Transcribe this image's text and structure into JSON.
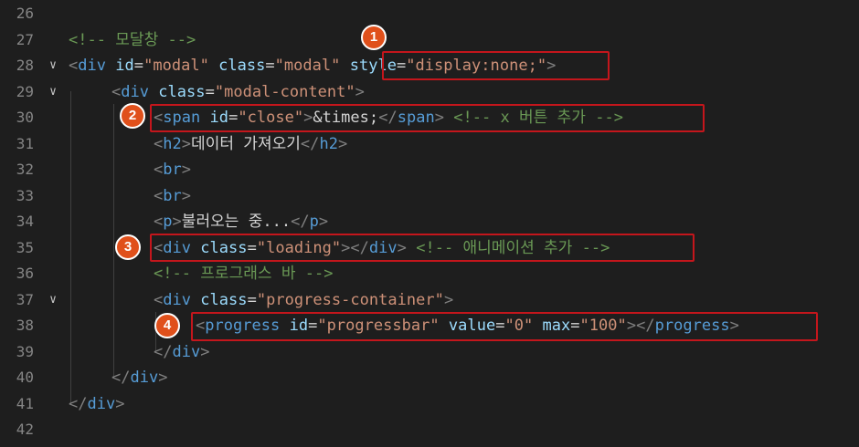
{
  "editor": {
    "lines": [
      {
        "num": "26"
      },
      {
        "num": "27",
        "comment": "<!-- 모달창 -->"
      },
      {
        "num": "28",
        "t1": "<",
        "tag": "div",
        "a1": " id",
        "eq1": "=",
        "v1": "\"modal\"",
        "a2": " class",
        "eq2": "=",
        "v2": "\"modal\"",
        "a3": "style",
        "eq3": "=",
        "v3": "\"display:none;\"",
        "close": ">"
      },
      {
        "num": "29",
        "t1": "<",
        "tag": "div",
        "a1": " class",
        "eq1": "=",
        "v1": "\"modal-content\"",
        "close": ">"
      },
      {
        "num": "30",
        "t1": "<",
        "tag": "span",
        "a1": " id",
        "eq1": "=",
        "v1": "\"close\"",
        "gt": ">",
        "entity": "&times;",
        "t2": "</",
        "tag2": "span",
        "gt2": ">",
        "comment": " <!-- x 버튼 추가 -->"
      },
      {
        "num": "31",
        "t1": "<",
        "tag": "h2",
        "gt": ">",
        "text": "데이터 가져오기",
        "t2": "</",
        "tag2": "h2",
        "gt2": ">"
      },
      {
        "num": "32",
        "t1": "<",
        "tag": "br",
        "gt": ">"
      },
      {
        "num": "33",
        "t1": "<",
        "tag": "br",
        "gt": ">"
      },
      {
        "num": "34",
        "t1": "<",
        "tag": "p",
        "gt": ">",
        "text": "불러오는 중...",
        "t2": "</",
        "tag2": "p",
        "gt2": ">"
      },
      {
        "num": "35",
        "t1": "<",
        "tag": "div",
        "a1": " class",
        "eq1": "=",
        "v1": "\"loading\"",
        "gt": ">",
        "t2": "</",
        "tag2": "div",
        "gt2": ">",
        "comment": " <!-- 애니메이션 추가 -->"
      },
      {
        "num": "36",
        "comment": "<!-- 프로그래스 바 -->"
      },
      {
        "num": "37",
        "t1": "<",
        "tag": "div",
        "a1": " class",
        "eq1": "=",
        "v1": "\"progress-container\"",
        "gt": ">"
      },
      {
        "num": "38",
        "t1": "<",
        "tag": "progress",
        "a1": " id",
        "eq1": "=",
        "v1": "\"progressbar\"",
        "a2": " value",
        "eq2": "=",
        "v2": "\"0\"",
        "a3": " max",
        "eq3": "=",
        "v3": "\"100\"",
        "gt": ">",
        "t2": "</",
        "tag2": "progress",
        "gt2": ">"
      },
      {
        "num": "39",
        "t1": "</",
        "tag": "div",
        "gt": ">"
      },
      {
        "num": "40",
        "t1": "</",
        "tag": "div",
        "gt": ">"
      },
      {
        "num": "41",
        "t1": "</",
        "tag": "div",
        "gt": ">"
      },
      {
        "num": "42"
      }
    ],
    "fold_marker": "∨"
  },
  "callouts": [
    {
      "label": "1"
    },
    {
      "label": "2"
    },
    {
      "label": "3"
    },
    {
      "label": "4"
    }
  ],
  "colors": {
    "background": "#1e1e1e",
    "tag": "#569cd6",
    "attribute": "#9cdcfe",
    "string": "#ce9178",
    "comment": "#6a9955",
    "highlight_box": "#c4161c",
    "badge": "#e0501b"
  }
}
